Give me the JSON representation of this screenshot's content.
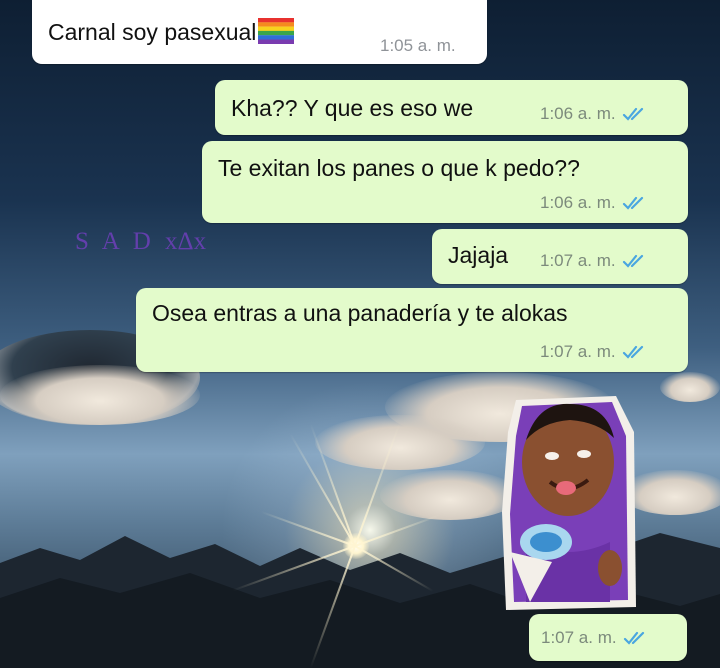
{
  "watermark": {
    "text": "S A D",
    "suffix": "xΔx"
  },
  "messages": [
    {
      "text": "Carnal soy pasexual",
      "emoji": "rainbow-flag",
      "time": "1:05 a. m.",
      "direction": "incoming"
    },
    {
      "text": "Kha?? Y que es eso we",
      "time": "1:06 a. m.",
      "direction": "outgoing",
      "status": "read"
    },
    {
      "text": "Te exitan los panes o que k pedo??",
      "time": "1:06 a. m.",
      "direction": "outgoing",
      "status": "read"
    },
    {
      "text": "Jajaja",
      "time": "1:07 a. m.",
      "direction": "outgoing",
      "status": "read"
    },
    {
      "text": "Osea entras a una panadería y te alokas",
      "time": "1:07 a. m.",
      "direction": "outgoing",
      "status": "read"
    },
    {
      "sticker": "kid-sticker",
      "time": "1:07 a. m.",
      "direction": "outgoing",
      "status": "read"
    }
  ],
  "colors": {
    "outgoing_bubble": "#e3fbcb",
    "incoming_bubble": "#ffffff",
    "read_tick": "#4aa6e0",
    "watermark": "#6a3fb5"
  }
}
